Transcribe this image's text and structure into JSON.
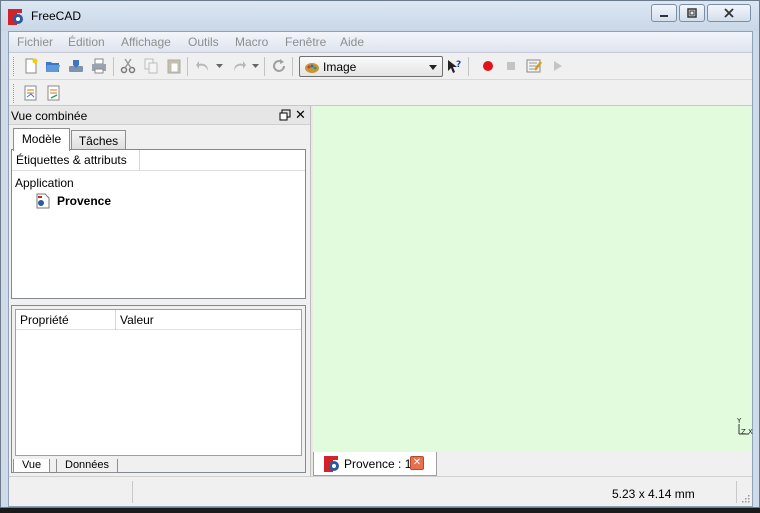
{
  "window": {
    "title": "FreeCAD"
  },
  "menu": {
    "items": [
      "Fichier",
      "Édition",
      "Affichage",
      "Outils",
      "Macro",
      "Fenêtre",
      "Aide"
    ]
  },
  "toolbar": {
    "workbench": "Image",
    "icons": [
      "new-icon",
      "open-icon",
      "save-icon",
      "print-icon",
      "cut-icon",
      "copy-icon",
      "paste-icon",
      "undo-icon",
      "redo-icon",
      "refresh-icon",
      "whats-this-icon",
      "record-macro-icon",
      "stop-macro-icon",
      "edit-macro-icon",
      "run-macro-icon",
      "open-image-icon",
      "create-image-plane-icon"
    ]
  },
  "combo_view": {
    "title": "Vue combinée",
    "tabs": [
      "Modèle",
      "Tâches"
    ],
    "tree": {
      "header": "Étiquettes & attributs",
      "root": "Application",
      "document": "Provence"
    },
    "properties": {
      "columns": [
        "Propriété",
        "Valeur"
      ]
    },
    "bottom_tabs": [
      "Vue",
      "Données"
    ]
  },
  "viewport": {
    "background": "#e3fbdd",
    "axis_labels": {
      "y": "Y",
      "z": "Z",
      "x": "X"
    }
  },
  "doc_tab": {
    "label": "Provence : 1"
  },
  "status": {
    "dimensions": "5.23 x 4.14 mm"
  },
  "colors": {
    "record": "#e0141a",
    "close_tab": "#e8704f",
    "viewport": "#e3fbdd"
  }
}
